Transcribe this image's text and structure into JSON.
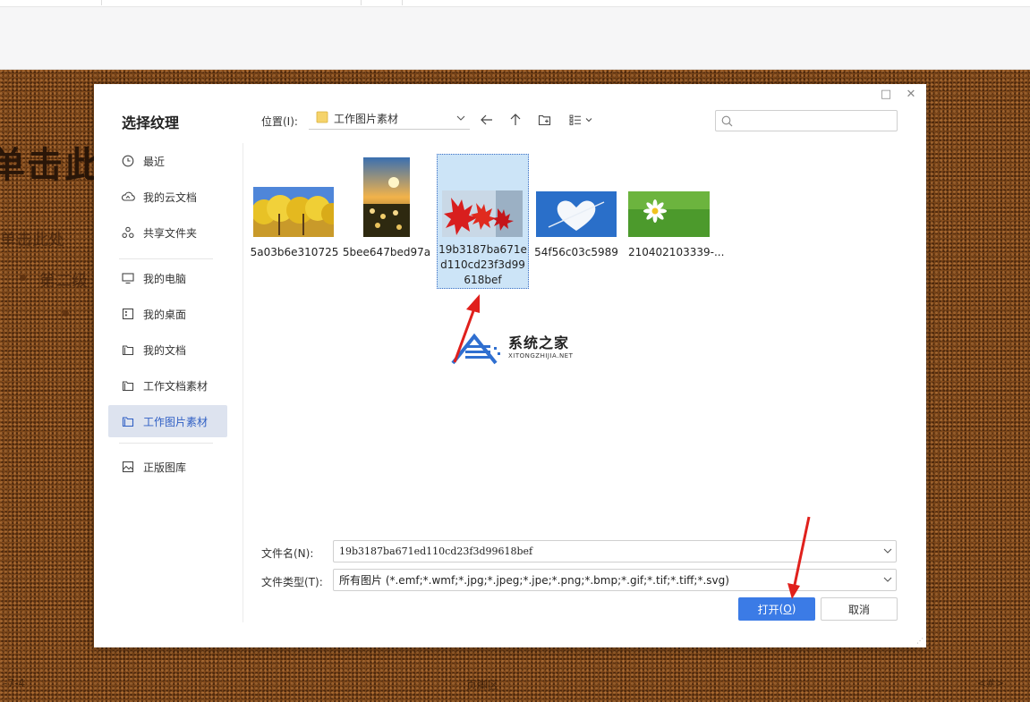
{
  "slide": {
    "title_fragment": "单击此",
    "ghost_line1": "单击此处",
    "ghost_line2": "第二级",
    "footer_left": "-7-4",
    "footer_center": "页脚区",
    "footer_right": "<#>"
  },
  "dialog": {
    "title": "选择纹理",
    "maximize_icon": "□",
    "close_icon": "✕",
    "sidebar": [
      {
        "label": "最近",
        "icon": "clock-icon"
      },
      {
        "label": "我的云文档",
        "icon": "cloud-icon"
      },
      {
        "label": "共享文件夹",
        "icon": "share-icon"
      },
      {
        "label": "我的电脑",
        "icon": "monitor-icon"
      },
      {
        "label": "我的桌面",
        "icon": "desktop-icon"
      },
      {
        "label": "我的文档",
        "icon": "folder-icon"
      },
      {
        "label": "工作文档素材",
        "icon": "folder-icon"
      },
      {
        "label": "工作图片素材",
        "icon": "folder-icon",
        "active": true
      },
      {
        "label": "正版图库",
        "icon": "gallery-icon"
      }
    ],
    "location": {
      "label": "位置(I):",
      "value": "工作图片素材"
    },
    "search": {
      "placeholder": ""
    },
    "files": [
      {
        "name": "5a03b6e310725",
        "thumb": "yellow-trees"
      },
      {
        "name": "5bee647bed97a",
        "thumb": "sunset-flowers"
      },
      {
        "name": "19b3187ba671ed110cd23f3d99618bef",
        "thumb": "red-maple",
        "selected": true
      },
      {
        "name": "54f56c03c5989",
        "thumb": "heart-cloud"
      },
      {
        "name": "210402103339-...",
        "thumb": "daisy"
      }
    ],
    "filename": {
      "label": "文件名(N):",
      "value": "19b3187ba671ed110cd23f3d99618bef"
    },
    "filetype": {
      "label": "文件类型(T):",
      "value": "所有图片 (*.emf;*.wmf;*.jpg;*.jpeg;*.jpe;*.png;*.bmp;*.gif;*.tif;*.tiff;*.svg)"
    },
    "buttons": {
      "open": "打开",
      "open_mnemonic": "O",
      "cancel": "取消"
    }
  },
  "watermark": {
    "cn": "系统之家",
    "en": "XITONGZHIJIA.NET"
  },
  "colors": {
    "accent": "#3b7be6",
    "selection": "#cce4f7",
    "active_nav": "#dde3ef",
    "annotation": "#e0201c",
    "slide_bg": "#7a4518"
  }
}
